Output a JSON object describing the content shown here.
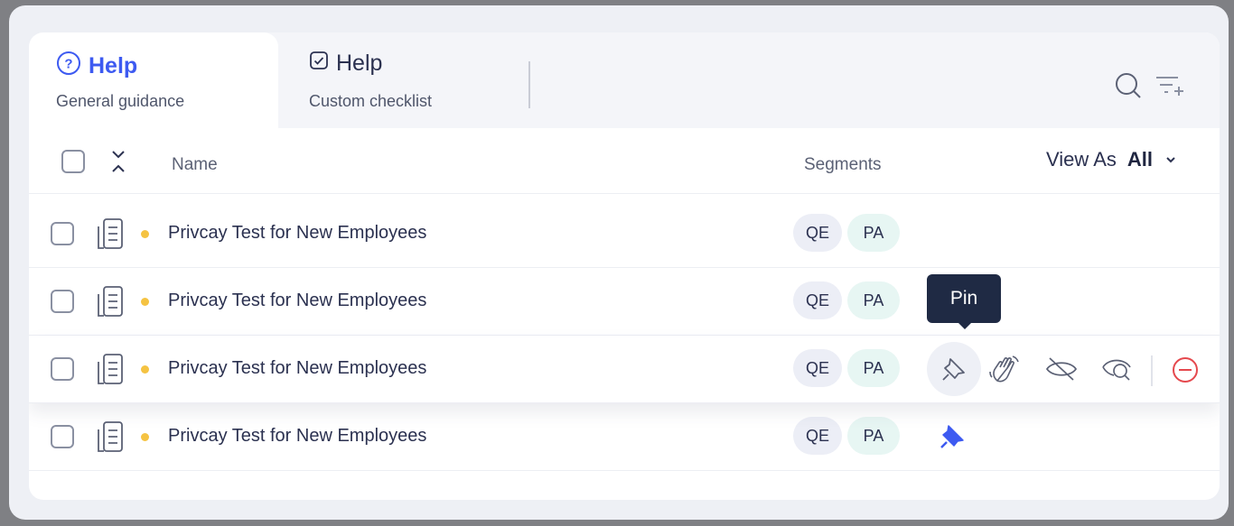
{
  "tabs": [
    {
      "title": "Help",
      "subtitle": "General guidance",
      "icon": "help-circle-icon",
      "active": true
    },
    {
      "title": "Help",
      "subtitle": "Custom checklist",
      "icon": "checkbox-icon",
      "active": false
    }
  ],
  "toolbar": {
    "search_icon": "search-icon",
    "filter_icon": "filter-add-icon"
  },
  "table": {
    "columns": {
      "name": "Name",
      "segments": "Segments"
    },
    "view_as": {
      "label": "View As",
      "value": "All"
    },
    "rows": [
      {
        "name": "Privcay Test for New Employees",
        "segments": [
          "QE",
          "PA"
        ],
        "pinned": false
      },
      {
        "name": "Privcay Test for New Employees",
        "segments": [
          "QE",
          "PA"
        ],
        "pinned": false
      },
      {
        "name": "Privcay Test for New Employees",
        "segments": [
          "QE",
          "PA"
        ],
        "pinned": false,
        "hovered": true
      },
      {
        "name": "Privcay Test for New Employees",
        "segments": [
          "QE",
          "PA"
        ],
        "pinned": true
      }
    ]
  },
  "tooltip": {
    "text": "Pin"
  },
  "row_actions": [
    "pin-icon",
    "wave-icon",
    "hide-icon",
    "preview-icon",
    "remove-icon"
  ],
  "colors": {
    "accent": "#3d5af1",
    "status_dot": "#f5c342",
    "remove": "#e5484d",
    "tooltip_bg": "#1f2a44"
  }
}
